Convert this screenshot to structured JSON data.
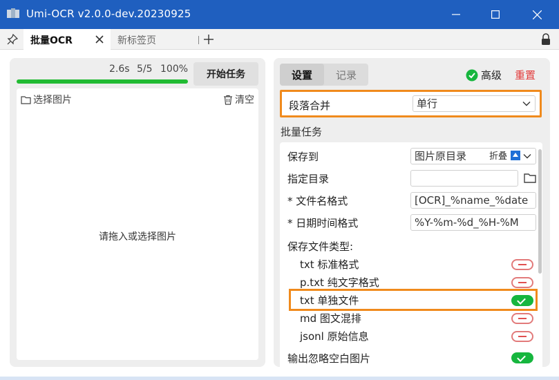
{
  "window": {
    "title": "Umi-OCR v2.0.0-dev.20230925",
    "title_color": "#1f5fbf"
  },
  "tabs": [
    {
      "label": "批量OCR",
      "active": true
    },
    {
      "label": "新标签页",
      "active": false
    }
  ],
  "left": {
    "time": "2.6s",
    "count": "5/5",
    "percent": "100%",
    "progress": 1.0,
    "start_button": "开始任务",
    "select_images": "选择图片",
    "clear": "清空",
    "drop_hint": "请拖入或选择图片"
  },
  "right": {
    "tab_settings": "设置",
    "tab_records": "记录",
    "advanced": "高级",
    "reset": "重置",
    "paragraph_merge": {
      "label": "段落合并",
      "value": "单行"
    },
    "batch_section": "批量任务",
    "save_to": {
      "label": "保存到",
      "value": "图片原目录"
    },
    "target_dir": {
      "label": "指定目录",
      "value": ""
    },
    "filename_format": {
      "label": "* 文件名格式",
      "value": "[OCR]_%name_%date"
    },
    "datetime_format": {
      "label": "* 日期时间格式",
      "value": "%Y-%m-%d_%H-%M"
    },
    "file_types": {
      "label": "保存文件类型:",
      "collapse": "折叠",
      "items": [
        {
          "label": "txt 标准格式",
          "enabled": false
        },
        {
          "label": "p.txt 纯文字格式",
          "enabled": false
        },
        {
          "label": "txt 单独文件",
          "enabled": true
        },
        {
          "label": "md 图文混排",
          "enabled": false
        },
        {
          "label": "jsonl 原始信息",
          "enabled": false
        }
      ]
    },
    "ignore_blank": {
      "label": "输出忽略空白图片",
      "enabled": true
    }
  },
  "colors": {
    "accent_orange": "#f08a1c",
    "toggle_on": "#16b63e",
    "reset_red": "#e23b3b",
    "progress_green": "#22bb33"
  }
}
